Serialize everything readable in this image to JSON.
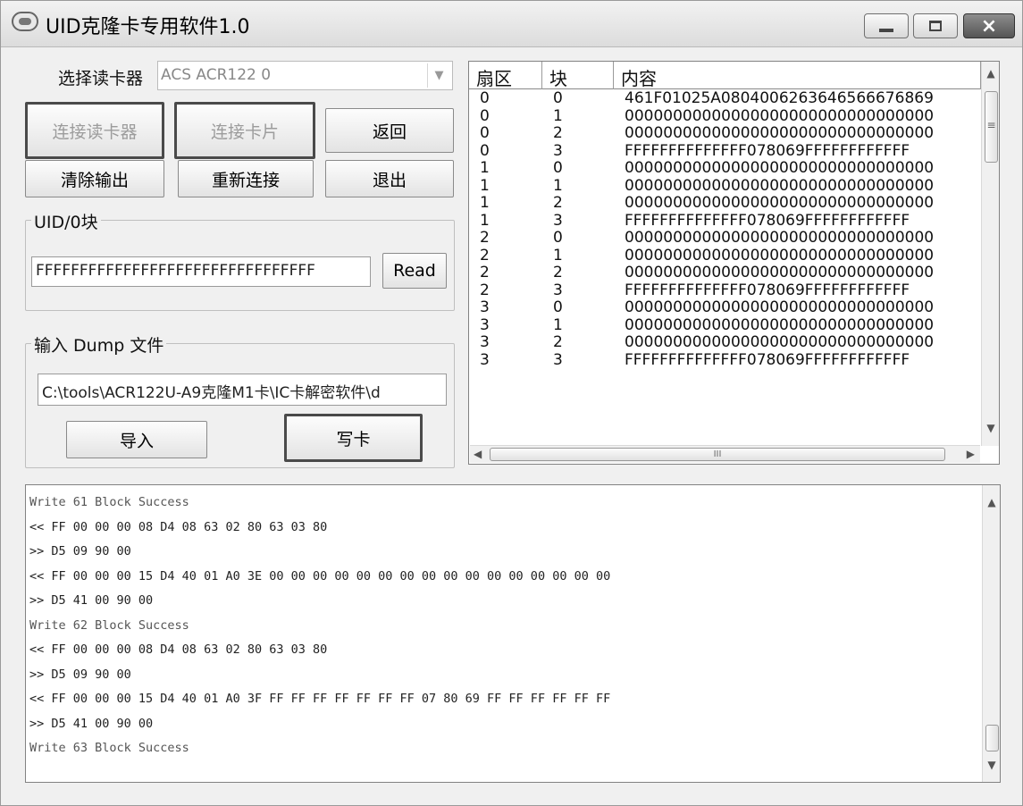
{
  "window": {
    "title": "UID克隆卡专用软件1.0",
    "close_glyph": "×"
  },
  "reader": {
    "label": "选择读卡器",
    "selected": "ACS ACR122 0"
  },
  "buttons": {
    "connect_reader": "连接读卡器",
    "connect_card": "连接卡片",
    "back": "返回",
    "clear_output": "清除输出",
    "reconnect": "重新连接",
    "exit": "退出",
    "read": "Read",
    "import": "导入",
    "write_card": "写卡"
  },
  "uid_group": {
    "title": "UID/0块",
    "value": "FFFFFFFFFFFFFFFFFFFFFFFFFFFFFFFF"
  },
  "dump_group": {
    "title": "输入 Dump 文件",
    "path": "C:\\tools\\ACR122U-A9克隆M1卡\\IC卡解密软件\\d"
  },
  "table": {
    "headers": [
      "扇区",
      "块",
      "内容"
    ],
    "rows": [
      [
        "0",
        "0",
        "461F01025A080400626364656667686 9"
      ],
      [
        "0",
        "1",
        "00000000000000000000000000000000"
      ],
      [
        "0",
        "2",
        "00000000000000000000000000000000"
      ],
      [
        "0",
        "3",
        "FFFFFFFFFFFFFF078069FFFFFFFFFFFF"
      ],
      [
        "1",
        "0",
        "00000000000000000000000000000000"
      ],
      [
        "1",
        "1",
        "00000000000000000000000000000000"
      ],
      [
        "1",
        "2",
        "00000000000000000000000000000000"
      ],
      [
        "1",
        "3",
        "FFFFFFFFFFFFFF078069FFFFFFFFFFFF"
      ],
      [
        "2",
        "0",
        "00000000000000000000000000000000"
      ],
      [
        "2",
        "1",
        "00000000000000000000000000000000"
      ],
      [
        "2",
        "2",
        "00000000000000000000000000000000"
      ],
      [
        "2",
        "3",
        "FFFFFFFFFFFFFF078069FFFFFFFFFFFF"
      ],
      [
        "3",
        "0",
        "00000000000000000000000000000000"
      ],
      [
        "3",
        "1",
        "00000000000000000000000000000000"
      ],
      [
        "3",
        "2",
        "00000000000000000000000000000000"
      ],
      [
        "3",
        "3",
        "FFFFFFFFFFFFFF078069FFFFFFFFFFFF"
      ]
    ]
  },
  "log": {
    "lines": [
      "Write 61 Block Success",
      "<< FF 00 00 00 08 D4 08 63 02 80 63 03 80",
      ">> D5 09 90 00",
      "<< FF 00 00 00 15 D4 40 01 A0 3E 00 00 00 00 00 00 00 00 00 00 00 00 00 00 00 00",
      ">> D5 41 00 90 00",
      "Write 62 Block Success",
      "<< FF 00 00 00 08 D4 08 63 02 80 63 03 80",
      ">> D5 09 90 00",
      "<< FF 00 00 00 15 D4 40 01 A0 3F FF FF FF FF FF FF FF 07 80 69 FF FF FF FF FF FF",
      ">> D5 41 00 90 00",
      "Write 63 Block Success"
    ]
  },
  "scroll": {
    "arrow_up": "▲",
    "arrow_down": "▼",
    "arrow_left": "◀",
    "arrow_right": "▶",
    "grip": "≡",
    "hgrip": "III",
    "combo_arrow": "▼"
  }
}
